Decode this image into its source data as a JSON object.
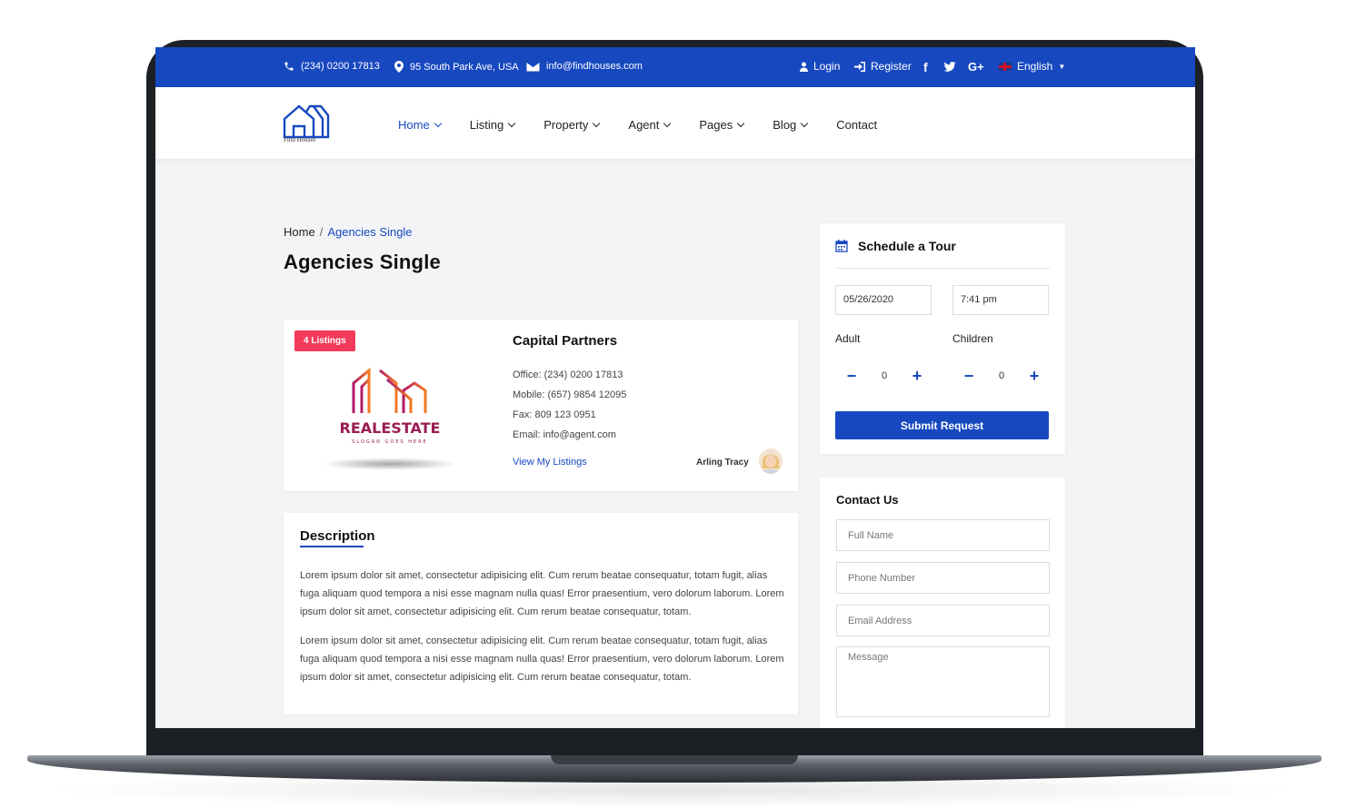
{
  "topbar": {
    "phone": "(234) 0200 17813",
    "address": "95 South Park Ave, USA",
    "email": "info@findhouses.com",
    "login": "Login",
    "register": "Register",
    "language": "English"
  },
  "header": {
    "logo_text": "Find Houses",
    "nav": [
      {
        "label": "Home"
      },
      {
        "label": "Listing"
      },
      {
        "label": "Property"
      },
      {
        "label": "Agent"
      },
      {
        "label": "Pages"
      },
      {
        "label": "Blog"
      },
      {
        "label": "Contact"
      }
    ]
  },
  "breadcrumb": {
    "home": "Home",
    "separator": "/",
    "current": "Agencies Single"
  },
  "page_title": "Agencies Single",
  "agency": {
    "badge": "4 Listings",
    "logo_word": "REALESTATE",
    "logo_slogan": "SLOGAN GOES HERE",
    "name": "Capital Partners",
    "office": "Office: (234) 0200 17813",
    "mobile": "Mobile: (657) 9854 12095",
    "fax": "Fax: 809 123 0951",
    "email": "Email: info@agent.com",
    "view_listings": "View My Listings",
    "agent_name": "Arling Tracy"
  },
  "description": {
    "title": "Description",
    "p1": "Lorem ipsum dolor sit amet, consectetur adipisicing elit. Cum rerum beatae consequatur, totam fugit, alias fuga aliquam quod tempora a nisi esse magnam nulla quas! Error praesentium, vero dolorum laborum. Lorem ipsum dolor sit amet, consectetur adipisicing elit. Cum rerum beatae consequatur, totam.",
    "p2": "Lorem ipsum dolor sit amet, consectetur adipisicing elit. Cum rerum beatae consequatur, totam fugit, alias fuga aliquam quod tempora a nisi esse magnam nulla quas! Error praesentium, vero dolorum laborum. Lorem ipsum dolor sit amet, consectetur adipisicing elit. Cum rerum beatae consequatur, totam."
  },
  "schedule": {
    "title": "Schedule a Tour",
    "date": "05/26/2020",
    "time": "7:41 pm",
    "adult_label": "Adult",
    "children_label": "Children",
    "adult_count": "0",
    "children_count": "0",
    "submit": "Submit Request"
  },
  "contact": {
    "title": "Contact Us",
    "full_name_placeholder": "Full Name",
    "phone_placeholder": "Phone Number",
    "email_placeholder": "Email Address",
    "message_placeholder": "Message"
  },
  "colors": {
    "primary": "#1848c0",
    "badge": "#f23a5a",
    "background": "#f3f4f6"
  }
}
